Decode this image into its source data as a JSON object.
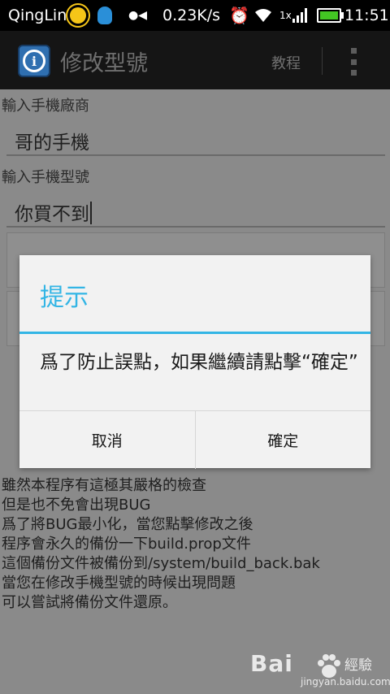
{
  "status_bar": {
    "carrier": "QingLin",
    "speed": "0.23K/s",
    "network_label": "1x",
    "time": "11:51",
    "icons": [
      "weather-sunny-icon",
      "qq-icon",
      "transfer-icon",
      "alarm-icon",
      "wifi-icon",
      "signal-icon",
      "battery-icon"
    ]
  },
  "action_bar": {
    "title": "修改型號",
    "help_label": "教程",
    "app_icon": "info-icon",
    "overflow_icon": "overflow-menu-icon"
  },
  "form": {
    "manufacturer_label": "輸入手機廠商",
    "manufacturer_value": "哥的手機",
    "model_label": "輸入手機型號",
    "model_value": "你買不到"
  },
  "notes": [
    "雖然本程序有這極其嚴格的檢查",
    "但是也不免會出現BUG",
    "爲了將BUG最小化，當您點擊修改之後",
    "程序會永久的備份一下build.prop文件",
    "這個備份文件被備份到/system/build_back.bak",
    "當您在修改手機型號的時候出現問題",
    "可以嘗試將備份文件還原。"
  ],
  "dialog": {
    "title": "提示",
    "message": "爲了防止誤點，如果繼續請點擊“確定”",
    "cancel_label": "取消",
    "confirm_label": "確定"
  },
  "watermark": {
    "brand": "Bai",
    "brand_suffix": "經驗",
    "url": "jingyan.baidu.com"
  },
  "colors": {
    "accent": "#33b5e5",
    "dim_overlay": "#8a8a8a",
    "battery": "#43c623"
  }
}
